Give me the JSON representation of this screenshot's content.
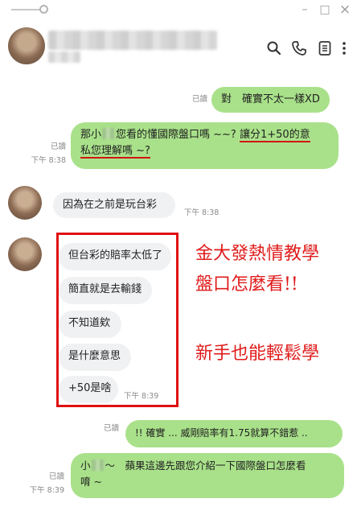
{
  "window": {
    "minimize_label": "–",
    "maximize_label": "□",
    "close_label": "×"
  },
  "header": {
    "icons": [
      "search-icon",
      "phone-icon",
      "notes-icon",
      "more-icon"
    ]
  },
  "messages": [
    {
      "id": "m1",
      "side": "me",
      "read": "已讀",
      "time": "",
      "text": "對　確實不太一樣XD"
    },
    {
      "id": "m2",
      "side": "me",
      "read": "已讀",
      "time": "下午 8:38",
      "text_a": "那小",
      "text_b": "您看的懂國際盤口嗎 ~~?",
      "text_c": "讓分1+50的意",
      "text_d": "私您理解嗎 ~?"
    },
    {
      "id": "m3",
      "side": "them",
      "time": "下午 8:38",
      "text": "因為在之前是玩台彩"
    },
    {
      "id": "m4",
      "side": "them",
      "text": "但台彩的賠率太低了"
    },
    {
      "id": "m5",
      "side": "them",
      "text": "簡直就是去輸錢"
    },
    {
      "id": "m6",
      "side": "them",
      "text": "不知道欸"
    },
    {
      "id": "m7",
      "side": "them",
      "text": "是什麼意思"
    },
    {
      "id": "m8",
      "side": "them",
      "time": "下午 8:39",
      "text": "+50是啥"
    },
    {
      "id": "m9",
      "side": "me",
      "read": "已讀",
      "time": "",
      "text": "!! 確實 ... 威剛賠率有1.75就算不錯惹 .."
    },
    {
      "id": "m10",
      "side": "me",
      "read": "已讀",
      "time": "下午 8:39",
      "text_a": "小",
      "text_b": "～　蘋果這邊先跟您介紹一下國際盤口怎麼看",
      "text_c": "唷 ~"
    }
  ],
  "promo": {
    "line1": "金大發熱情教學",
    "line2": "盤口怎麼看!!",
    "line3": "新手也能輕鬆學"
  },
  "colors": {
    "my_bubble": "#a9e18a",
    "their_bubble": "#f0f1f3",
    "annotation_red": "#e01010"
  }
}
